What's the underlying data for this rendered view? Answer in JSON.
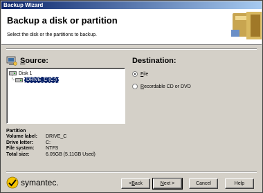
{
  "window": {
    "title": "Backup Wizard"
  },
  "header": {
    "title": "Backup a disk or partition",
    "subtitle": "Select the disk or the partitions to backup."
  },
  "source": {
    "label_underlined": "S",
    "label_rest": "ource:",
    "tree": [
      {
        "label": "Disk 1",
        "level": 0,
        "selected": false
      },
      {
        "label": "DRIVE_C (C:)",
        "level": 1,
        "selected": true
      }
    ]
  },
  "destination": {
    "label": "Destination:",
    "options": [
      {
        "underlined": "F",
        "rest": "ile",
        "checked": true
      },
      {
        "underlined": "R",
        "rest": "ecordable CD or DVD",
        "checked": false
      }
    ]
  },
  "partition_info": {
    "title": "Partition",
    "rows": [
      {
        "key": "Volume label:",
        "value": "DRIVE_C"
      },
      {
        "key": "Drive letter:",
        "value": "C:"
      },
      {
        "key": "File system:",
        "value": "NTFS"
      },
      {
        "key": "Total size:",
        "value": "6.05GB (5.11GB Used)"
      }
    ]
  },
  "brand": {
    "name": "symantec."
  },
  "buttons": {
    "back": {
      "underlined": "B",
      "pre": "< ",
      "rest": "ack"
    },
    "next": {
      "underlined": "N",
      "pre": "",
      "rest": "ext >"
    },
    "cancel": "Cancel",
    "help": "Help"
  },
  "colors": {
    "selection": "#0a246a",
    "titlebar": "#0a246a",
    "face": "#d4d0c8"
  }
}
